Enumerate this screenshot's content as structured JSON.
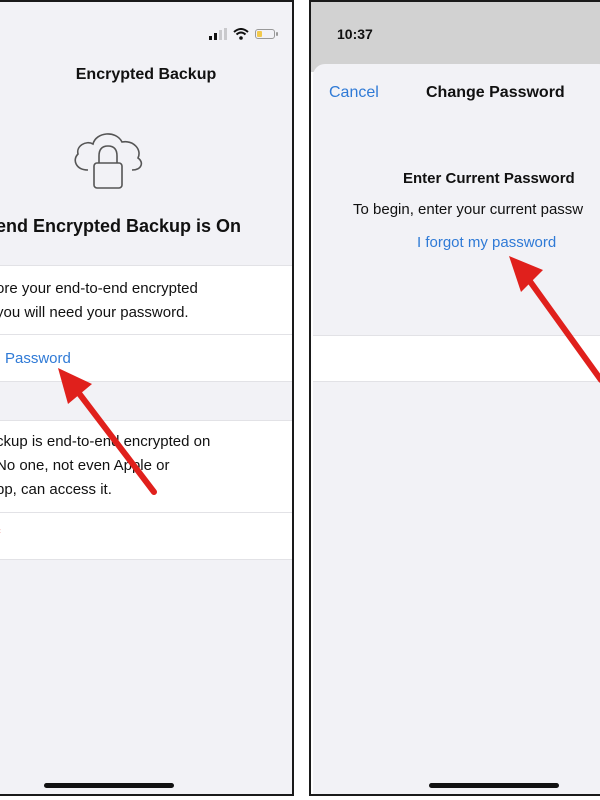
{
  "left_screen": {
    "title": "Encrypted Backup",
    "heading": "o-end Encrypted Backup is On",
    "card1": {
      "line1": "ore your end-to-end encrypted",
      "line2": " you will need your password.",
      "link": "Password"
    },
    "card2": {
      "line1": "ckup is end-to-end encrypted on",
      "line2": "No one, not even Apple or",
      "line3": "pp, can access it.",
      "red_text": "f"
    },
    "icons": [
      "signal-icon",
      "wifi-icon",
      "battery-icon",
      "cloud-lock-icon"
    ]
  },
  "right_screen": {
    "time": "10:37",
    "cancel": "Cancel",
    "title": "Change Password",
    "heading": "Enter Current Password",
    "subtitle": "To begin, enter your current passw",
    "forgot_link": "I forgot my password"
  },
  "colors": {
    "link": "#2f7ad6",
    "arrow": "#e0201c",
    "destructive": "#e53935",
    "background": "#f2f2f6"
  }
}
